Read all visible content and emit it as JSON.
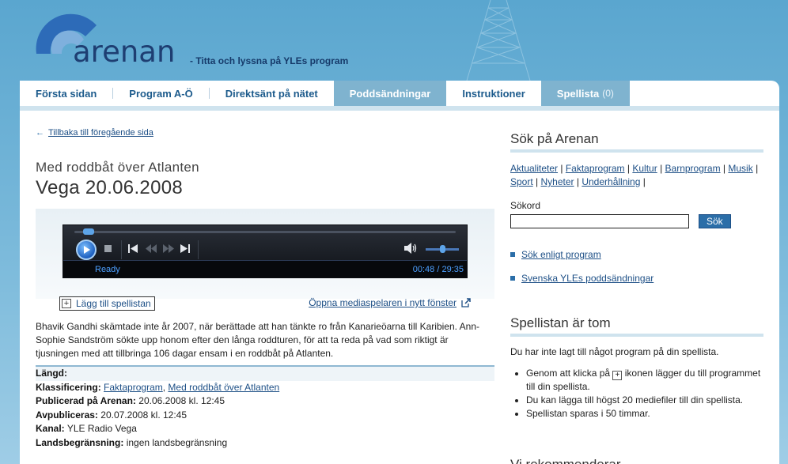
{
  "header": {
    "logo_text": "arenan",
    "tagline": "- Titta och lyssna på YLEs program"
  },
  "nav": {
    "items": [
      {
        "label": "Första sidan"
      },
      {
        "label": "Program A-Ö"
      },
      {
        "label": "Direktsänt på nätet"
      },
      {
        "label": "Poddsändningar"
      },
      {
        "label": "Instruktioner"
      }
    ],
    "playlist_label": "Spellista",
    "playlist_count": "(0)"
  },
  "main": {
    "back_link": "Tillbaka till föregående sida",
    "program_subtitle": "Med roddbåt över Atlanten",
    "program_title": "Vega 20.06.2008",
    "player": {
      "status": "Ready",
      "time": "00:48 / 29:35",
      "position_fraction": 0.027,
      "volume_fraction": 0.5
    },
    "add_playlist_label": "Lägg till spellistan",
    "open_player_label": "Öppna mediaspelaren i nytt fönster",
    "description": "Bhavik Gandhi skämtade inte år 2007, när berättade att han tänkte ro från Kanarieöarna till Karibien. Ann-Sophie Sandström sökte upp honom efter den långa roddturen, för att ta reda på vad som riktigt är tjusningen med att tillbringa 106 dagar ensam i en roddbåt på Atlanten.",
    "meta": {
      "length_label": "Längd:",
      "length_value": "",
      "class_label": "Klassificering:",
      "class_link1": "Faktaprogram",
      "class_sep": ", ",
      "class_link2": "Med roddbåt över Atlanten",
      "published_label": "Publicerad på Arenan:",
      "published_value": "20.06.2008 kl. 12:45",
      "unpublish_label": "Avpubliceras:",
      "unpublish_value": "20.07.2008 kl. 12:45",
      "channel_label": "Kanal:",
      "channel_value": "YLE Radio Vega",
      "region_label": "Landsbegränsning:",
      "region_value": "ingen landsbegränsning"
    }
  },
  "sidebar": {
    "search_heading": "Sök på Arenan",
    "categories": [
      "Aktualiteter",
      "Faktaprogram",
      "Kultur",
      "Barnprogram",
      "Musik",
      "Sport",
      "Nyheter",
      "Underhållning"
    ],
    "category_sep": "|",
    "search_label": "Sökord",
    "search_value": "",
    "search_placeholder": "",
    "search_button": "Sök",
    "link_by_program": "Sök enligt program",
    "link_podcasts": "Svenska YLEs poddsändningar",
    "playlist_heading": "Spellistan är tom",
    "playlist_intro": "Du har inte lagt till något program på din spellista.",
    "tip1_pre": "Genom att klicka på",
    "tip1_post": "ikonen lägger du till programmet till din spellista.",
    "tip2": "Du kan lägga till högst 20 mediefiler till din spellista.",
    "tip3": "Spellistan sparas i 50 timmar.",
    "recommend_heading": "Vi rekommenderar"
  },
  "colors": {
    "accent": "#1d4f86",
    "tab_active": "#7fb3cf",
    "player_text": "#4da0ff"
  }
}
